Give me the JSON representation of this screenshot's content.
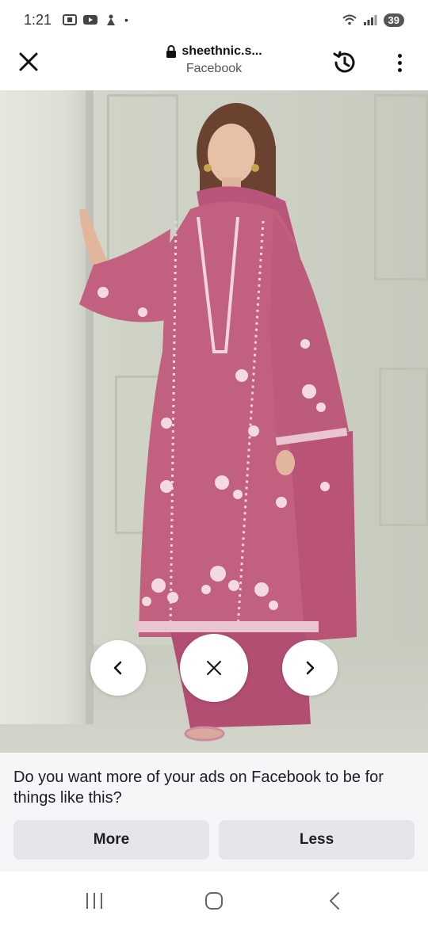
{
  "status_bar": {
    "time": "1:21",
    "battery": "39",
    "dot": "•"
  },
  "browser": {
    "url": "sheethnic.s...",
    "source": "Facebook"
  },
  "photo": {
    "description_icon": "product-photo"
  },
  "carousel": {
    "prev_icon": "chevron-left-icon",
    "dismiss_icon": "close-icon",
    "next_icon": "chevron-right-icon"
  },
  "survey": {
    "question": "Do you want more of your ads on Facebook to be for things like this?",
    "more_label": "More",
    "less_label": "Less"
  },
  "colors": {
    "dress": "#c2607f",
    "survey_bg": "#f5f6f8",
    "button_bg": "#e4e6eb"
  }
}
